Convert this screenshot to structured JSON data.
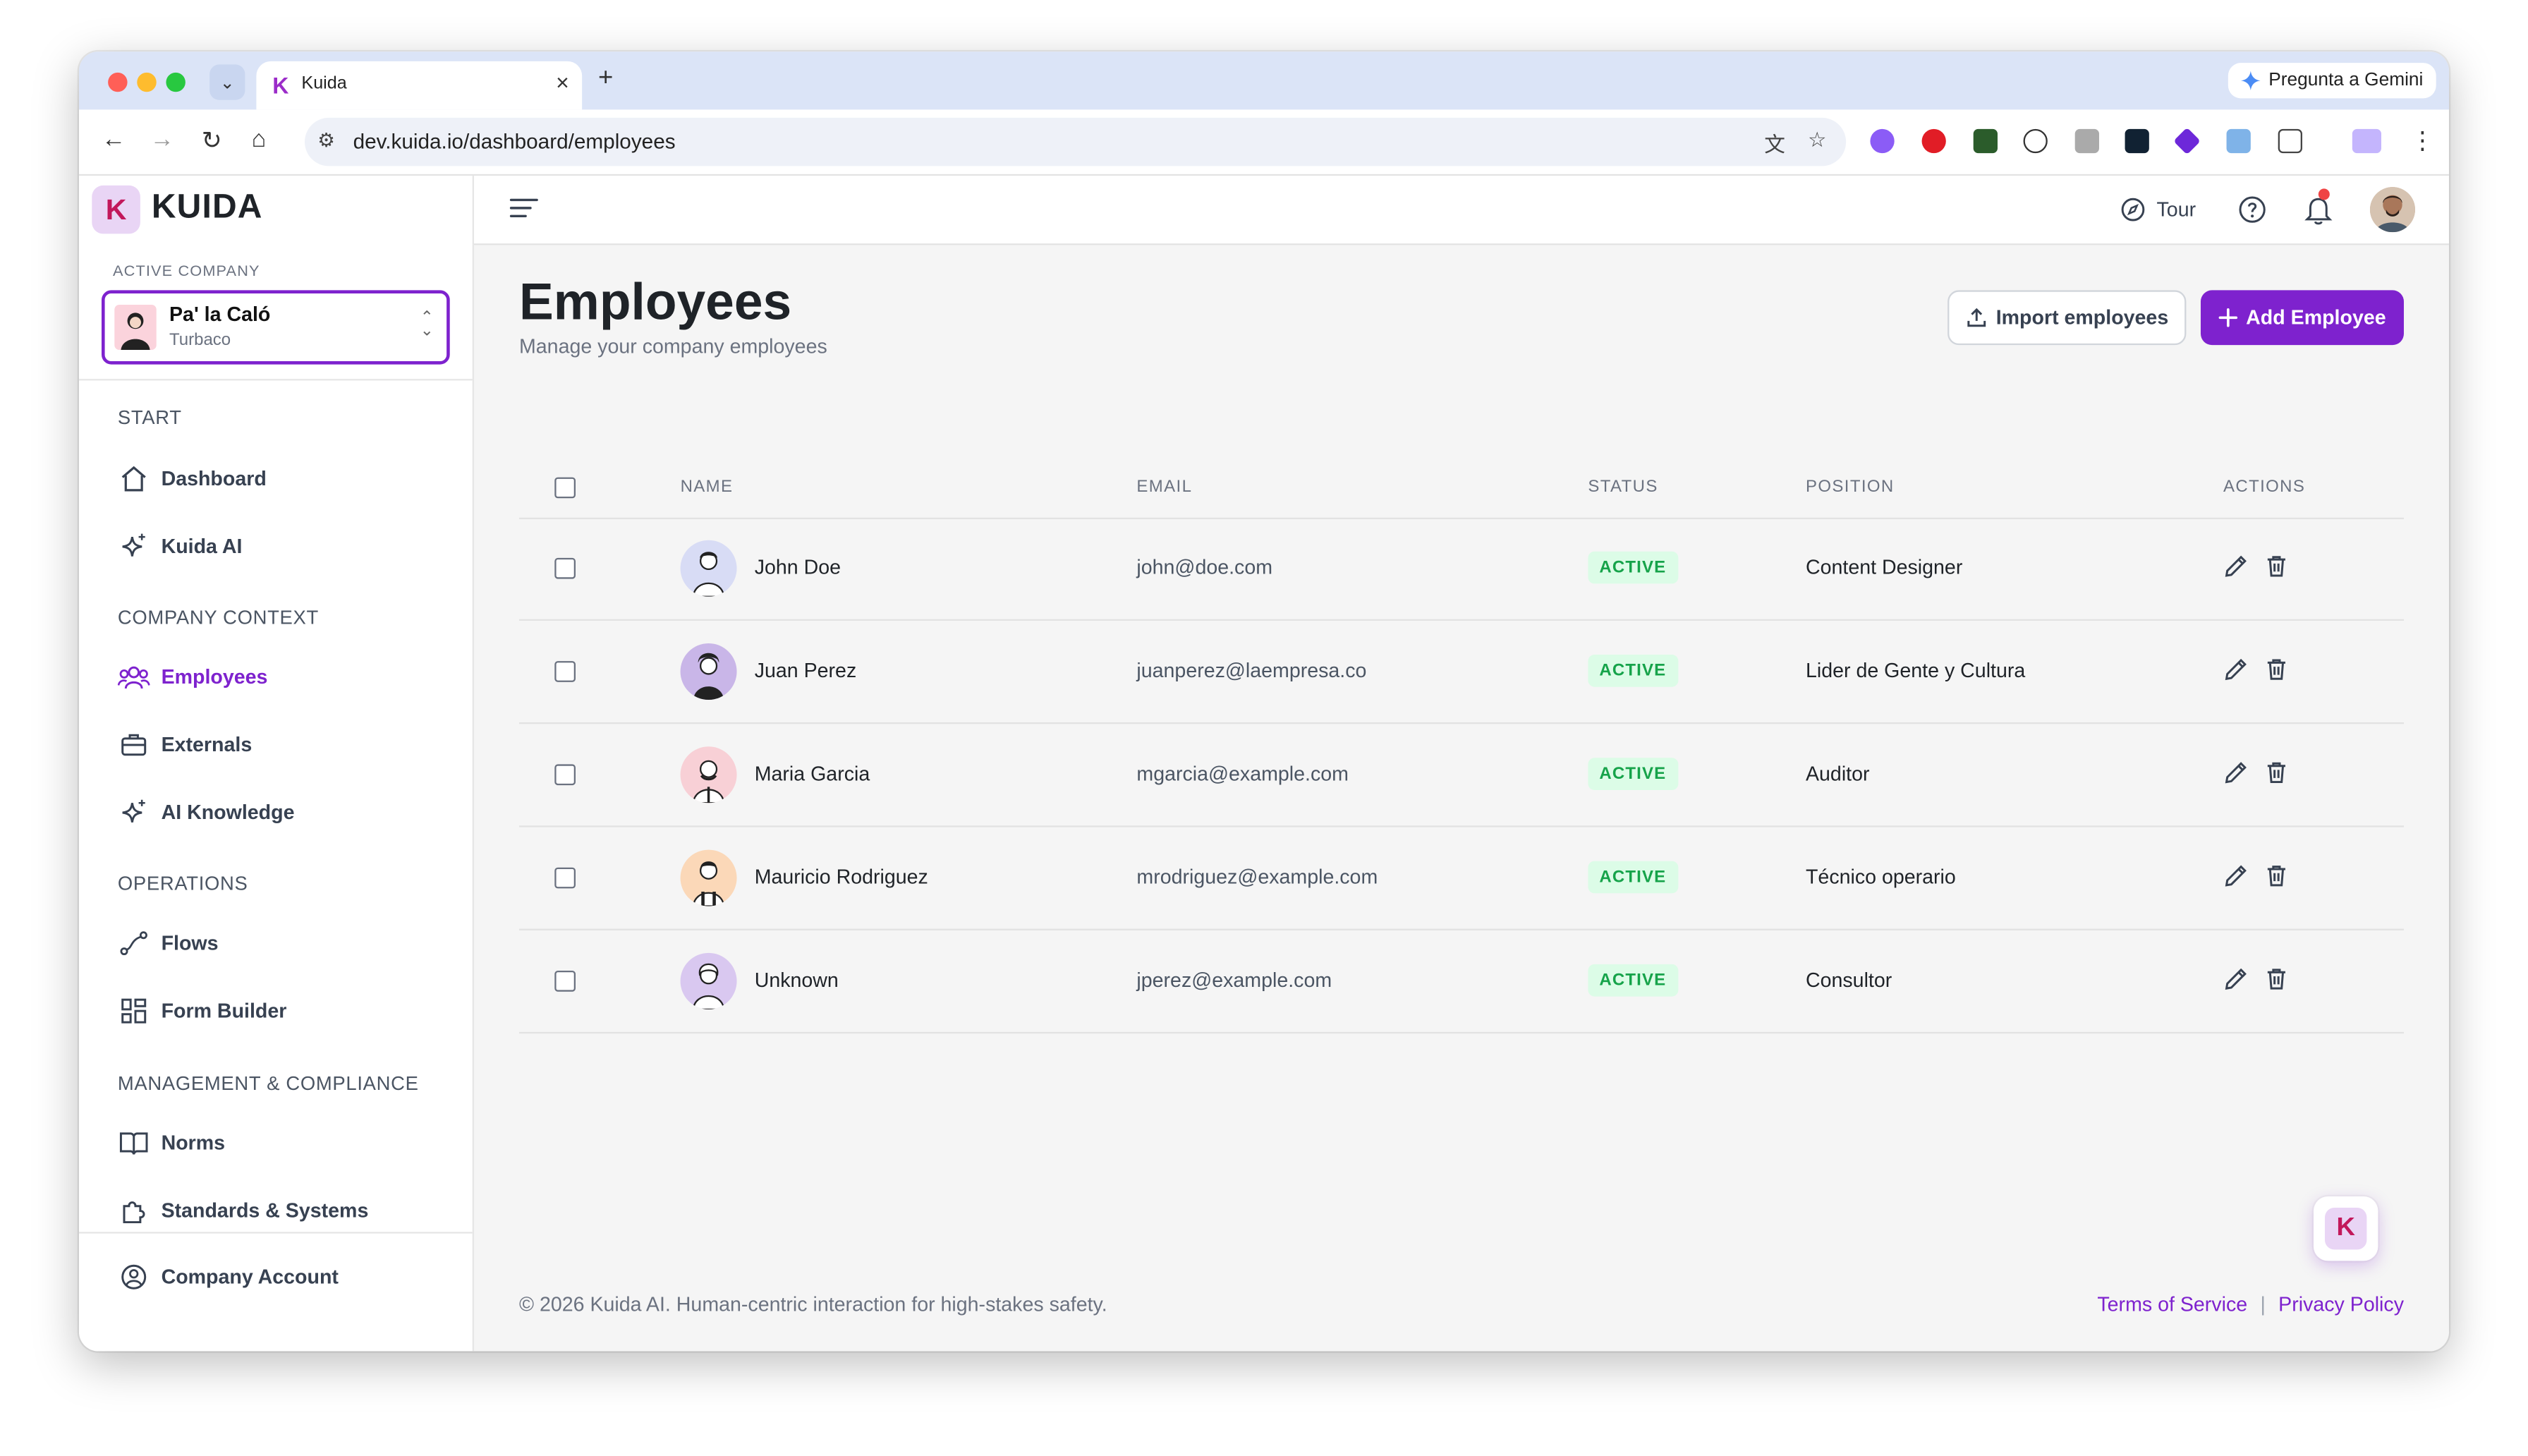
{
  "browser": {
    "tab_title": "Kuida",
    "url": "dev.kuida.io/dashboard/employees",
    "gemini_label": "Pregunta a Gemini",
    "new_tab": "+",
    "close_tab": "×"
  },
  "sidebar": {
    "logo_text": "KUIDA",
    "logo_letter": "K",
    "active_company_label": "ACTIVE COMPANY",
    "company_name": "Pa' la Caló",
    "company_city": "Turbaco",
    "sections": {
      "start": "START",
      "company_context": "COMPANY CONTEXT",
      "operations": "OPERATIONS",
      "management": "MANAGEMENT & COMPLIANCE"
    },
    "items": {
      "dashboard": "Dashboard",
      "kuida_ai": "Kuida AI",
      "employees": "Employees",
      "externals": "Externals",
      "ai_knowledge": "AI Knowledge",
      "flows": "Flows",
      "form_builder": "Form Builder",
      "norms": "Norms",
      "standards": "Standards & Systems",
      "company_account": "Company Account"
    }
  },
  "topbar": {
    "tour_label": "Tour"
  },
  "page": {
    "title": "Employees",
    "subtitle": "Manage your company employees",
    "import_label": "Import employees",
    "add_label": "Add Employee"
  },
  "table": {
    "headers": {
      "name": "NAME",
      "email": "EMAIL",
      "status": "STATUS",
      "position": "POSITION",
      "actions": "ACTIONS"
    },
    "rows": [
      {
        "name": "John Doe",
        "email": "john@doe.com",
        "status": "ACTIVE",
        "position": "Content Designer",
        "avatar_bg": "#d8dcf5"
      },
      {
        "name": "Juan Perez",
        "email": "juanperez@laempresa.co",
        "status": "ACTIVE",
        "position": "Lider de Gente y Cultura",
        "avatar_bg": "#c9b6e8"
      },
      {
        "name": "Maria Garcia",
        "email": "mgarcia@example.com",
        "status": "ACTIVE",
        "position": "Auditor",
        "avatar_bg": "#f8d0d6"
      },
      {
        "name": "Mauricio Rodriguez",
        "email": "mrodriguez@example.com",
        "status": "ACTIVE",
        "position": "Técnico operario",
        "avatar_bg": "#fbd8b8"
      },
      {
        "name": "Unknown",
        "email": "jperez@example.com",
        "status": "ACTIVE",
        "position": "Consultor",
        "avatar_bg": "#d9c8f0"
      }
    ]
  },
  "footer": {
    "copyright": "© 2026 Kuida AI. Human-centric interaction for high-stakes safety.",
    "terms": "Terms of Service",
    "separator": "|",
    "privacy": "Privacy Policy"
  },
  "colors": {
    "accent": "#7e22ce",
    "status_green": "#16a34a",
    "status_bg": "#dcfce7"
  }
}
